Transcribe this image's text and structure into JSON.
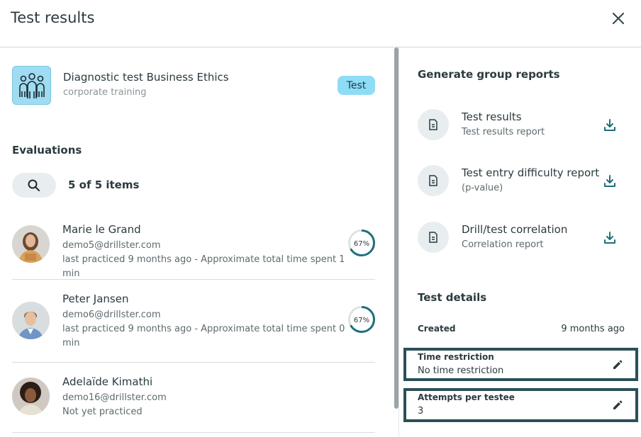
{
  "header": {
    "title": "Test results"
  },
  "course": {
    "title": "Diagnostic test Business Ethics",
    "subtitle": "corporate training",
    "badge": "Test"
  },
  "evaluations": {
    "title": "Evaluations",
    "count_label": "5 of 5 items",
    "people": [
      {
        "name": "Marie le Grand",
        "email": "demo5@drillster.com",
        "meta": "last practiced 9 months ago - Approximate total time spent 1 min",
        "progress": "67%",
        "progress_fraction": 0.67
      },
      {
        "name": "Peter Jansen",
        "email": "demo6@drillster.com",
        "meta": "last practiced 9 months ago - Approximate total time spent 0 min",
        "progress": "67%",
        "progress_fraction": 0.67
      },
      {
        "name": "Adelaïde Kimathi",
        "email": "demo16@drillster.com",
        "meta": "Not yet practiced"
      }
    ]
  },
  "reports": {
    "title": "Generate group reports",
    "items": [
      {
        "name": "Test results",
        "sub": "Test results report"
      },
      {
        "name": "Test entry difficulty report",
        "sub": "(p-value)"
      },
      {
        "name": "Drill/test correlation",
        "sub": "Correlation report"
      }
    ]
  },
  "details": {
    "title": "Test details",
    "created_label": "Created",
    "created_value": "9 months ago",
    "time_label": "Time restriction",
    "time_value": "No time restriction",
    "attempts_label": "Attempts per testee",
    "attempts_value": "3"
  },
  "colors": {
    "accent": "#1f6f7a",
    "highlight_border": "#2a5058",
    "badge_bg": "#8fdcf6",
    "logo_bg": "#9fdcf2"
  },
  "icons": [
    "close-icon",
    "team-icon",
    "search-icon",
    "document-icon",
    "download-icon",
    "pencil-icon"
  ]
}
